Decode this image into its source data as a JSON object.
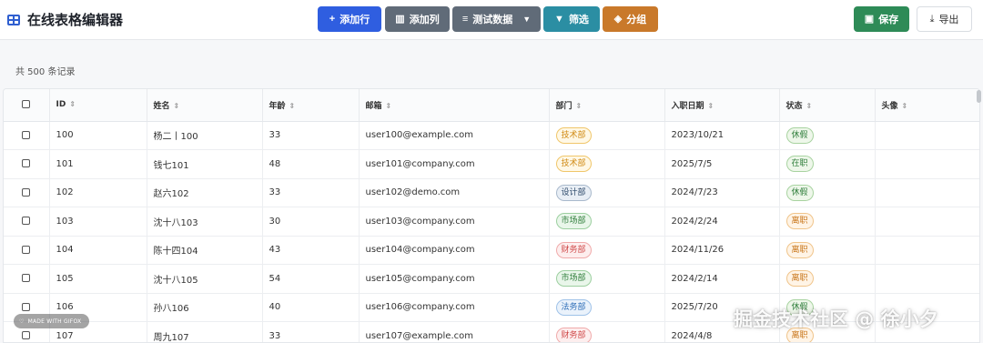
{
  "header": {
    "title": "在线表格编辑器",
    "buttons": {
      "add_row": "添加行",
      "add_col": "添加列",
      "test_data": "测试数据",
      "filter": "筛选",
      "group": "分组",
      "save": "保存",
      "export": "导出"
    }
  },
  "summary": "共 500 条记录",
  "columns": [
    "ID",
    "姓名",
    "年龄",
    "邮箱",
    "部门",
    "入职日期",
    "状态",
    "头像"
  ],
  "rows": [
    {
      "id": "100",
      "name": "杨二丨100",
      "age": "33",
      "email": "user100@example.com",
      "dept": "技术部",
      "dept_class": "d-tech",
      "date": "2023/10/21",
      "status": "休假",
      "status_class": "s-leave"
    },
    {
      "id": "101",
      "name": "钱七101",
      "age": "48",
      "email": "user101@company.com",
      "dept": "技术部",
      "dept_class": "d-tech",
      "date": "2025/7/5",
      "status": "在职",
      "status_class": "s-active"
    },
    {
      "id": "102",
      "name": "赵六102",
      "age": "33",
      "email": "user102@demo.com",
      "dept": "设计部",
      "dept_class": "d-design",
      "date": "2024/7/23",
      "status": "休假",
      "status_class": "s-leave"
    },
    {
      "id": "103",
      "name": "沈十八103",
      "age": "30",
      "email": "user103@company.com",
      "dept": "市场部",
      "dept_class": "d-market",
      "date": "2024/2/24",
      "status": "离职",
      "status_class": "s-quit"
    },
    {
      "id": "104",
      "name": "陈十四104",
      "age": "43",
      "email": "user104@company.com",
      "dept": "财务部",
      "dept_class": "d-finance",
      "date": "2024/11/26",
      "status": "离职",
      "status_class": "s-quit"
    },
    {
      "id": "105",
      "name": "沈十八105",
      "age": "54",
      "email": "user105@company.com",
      "dept": "市场部",
      "dept_class": "d-market",
      "date": "2024/2/14",
      "status": "离职",
      "status_class": "s-quit"
    },
    {
      "id": "106",
      "name": "孙八106",
      "age": "40",
      "email": "user106@company.com",
      "dept": "法务部",
      "dept_class": "d-legal",
      "date": "2025/7/20",
      "status": "休假",
      "status_class": "s-leave"
    },
    {
      "id": "107",
      "name": "周九107",
      "age": "33",
      "email": "user107@example.com",
      "dept": "财务部",
      "dept_class": "d-finance",
      "date": "2024/4/8",
      "status": "离职",
      "status_class": "s-quit"
    }
  ],
  "overlay": {
    "gifox": "MADE WITH GIFOX",
    "watermark": "掘金技术社区 @ 徐小夕"
  },
  "icons": {
    "logo": "table-icon",
    "add_row": "plus-icon",
    "add_col": "columns-icon",
    "test_data": "database-icon",
    "filter": "funnel-icon",
    "group": "layers-icon",
    "save": "floppy-icon",
    "export": "download-icon",
    "sort": "sort-icon"
  }
}
